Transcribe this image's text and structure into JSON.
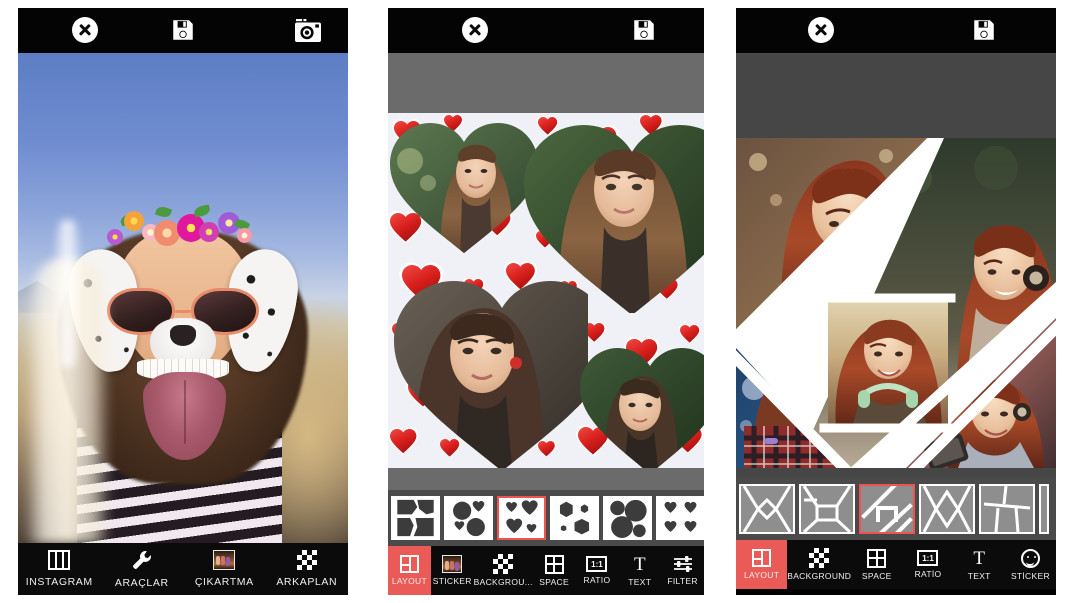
{
  "app": {
    "screenshot_title": "Photo collage app - three phone screens"
  },
  "panel1": {
    "name": "photo-editor-screen",
    "topbar": {
      "close_label": "close",
      "save_label": "save",
      "instagram_label": "instagram"
    },
    "photo": {
      "description": "Woman at beach with dalmatian dog face filter, flower crown and sunglasses"
    },
    "tabs": [
      {
        "label": "INSTAGRAM",
        "icon": "columns-icon",
        "active": false
      },
      {
        "label": "ARAÇLAR",
        "icon": "wrench-icon",
        "active": false
      },
      {
        "label": "ÇIKARTMA",
        "icon": "sticker-icon",
        "active": false
      },
      {
        "label": "ARKAPLAN",
        "icon": "checkerboard-icon",
        "active": false
      }
    ]
  },
  "panel2": {
    "name": "heart-collage-screen",
    "topbar": {
      "close_label": "close",
      "save_label": "save"
    },
    "collage": {
      "description": "Four heart-shaped photo frames of young women on a red hearts background",
      "background": "red-hearts-pattern",
      "frames": 4
    },
    "layout_thumbnails": [
      {
        "name": "puzzle-4",
        "selected": false
      },
      {
        "name": "circles-4",
        "selected": false
      },
      {
        "name": "hearts-4",
        "selected": true
      },
      {
        "name": "hexagons-4",
        "selected": false
      },
      {
        "name": "circles-big-4",
        "selected": false
      },
      {
        "name": "hearts-6",
        "selected": false
      }
    ],
    "tabs": [
      {
        "label": "LAYOUT",
        "icon": "layout-icon",
        "active": true
      },
      {
        "label": "STICKER",
        "icon": "sticker-icon",
        "active": false
      },
      {
        "label": "BACKGROU...",
        "icon": "checkerboard-icon",
        "active": false
      },
      {
        "label": "SPACE",
        "icon": "grid-icon",
        "active": false
      },
      {
        "label": "RATIO",
        "icon": "ratio-icon",
        "active": false,
        "badge": "1:1"
      },
      {
        "label": "TEXT",
        "icon": "text-icon",
        "active": false
      },
      {
        "label": "FILTER",
        "icon": "filter-icon",
        "active": false
      }
    ]
  },
  "panel3": {
    "name": "diagonal-collage-screen",
    "topbar": {
      "close_label": "close",
      "save_label": "save"
    },
    "collage": {
      "description": "Five diagonal photo panes of red-haired women with phones and headphones",
      "frames": 5
    },
    "layout_thumbnails": [
      {
        "name": "diamond-center",
        "selected": false
      },
      {
        "name": "frame-inset",
        "selected": false
      },
      {
        "name": "diagonal-pinwheel",
        "selected": true
      },
      {
        "name": "hexagon-center",
        "selected": false
      },
      {
        "name": "brick-split",
        "selected": false
      }
    ],
    "tabs": [
      {
        "label": "LAYOUT",
        "icon": "layout-icon",
        "active": true
      },
      {
        "label": "BACKGROUND",
        "icon": "checkerboard-icon",
        "active": false
      },
      {
        "label": "SPACE",
        "icon": "grid-icon",
        "active": false
      },
      {
        "label": "RATİO",
        "icon": "ratio-icon",
        "active": false,
        "badge": "1:1"
      },
      {
        "label": "TEXT",
        "icon": "text-icon",
        "active": false
      },
      {
        "label": "STİCKER",
        "icon": "smiley-icon",
        "active": false
      }
    ]
  },
  "colors": {
    "accent_red": "#ea5b57",
    "selected_border": "#ef5350",
    "topbar_black": "#040404",
    "tabbar_black": "#0b0b0b",
    "gray_band_light": "#6b6b6b",
    "gray_band_dark": "#464646",
    "strip_bg": "#4a4a4a",
    "heart_red": "#e02b26"
  }
}
